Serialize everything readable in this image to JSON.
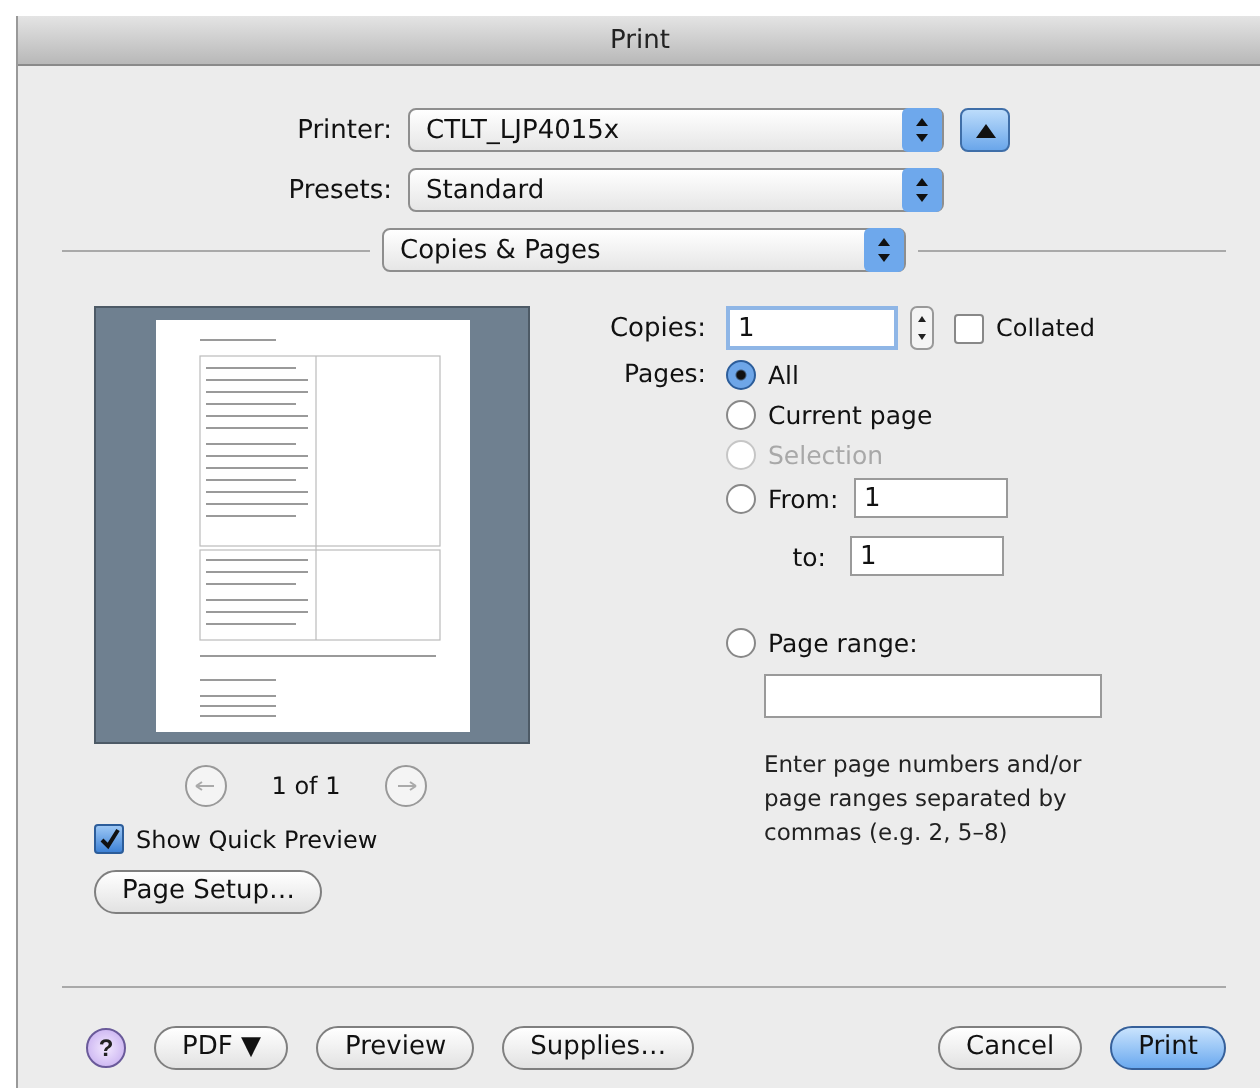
{
  "window": {
    "title": "Print"
  },
  "printer": {
    "label": "Printer:",
    "value": "CTLT_LJP4015x"
  },
  "presets": {
    "label": "Presets:",
    "value": "Standard"
  },
  "details_toggle": {
    "expanded": true
  },
  "panel_menu": {
    "value": "Copies & Pages"
  },
  "preview": {
    "page_indicator": "1 of 1",
    "quick_preview": {
      "label": "Show Quick Preview",
      "checked": true
    },
    "page_setup": "Page Setup…"
  },
  "copies": {
    "label": "Copies:",
    "value": "1",
    "collated": {
      "label": "Collated",
      "checked": false
    }
  },
  "pages": {
    "label": "Pages:",
    "options": [
      {
        "kind": "plain",
        "label": "All",
        "selected": true,
        "disabled": false
      },
      {
        "kind": "plain",
        "label": "Current page",
        "selected": false,
        "disabled": false
      },
      {
        "kind": "plain",
        "label": "Selection",
        "selected": false,
        "disabled": true
      },
      {
        "kind": "from_to",
        "label": "From:",
        "value": "1",
        "to_label": "to:",
        "to_value": "1",
        "selected": false,
        "disabled": false
      },
      {
        "kind": "range",
        "label": "Page range:",
        "hint": "Enter page numbers and/or page ranges separated by commas (e.g. 2, 5–8)",
        "selected": false,
        "disabled": false
      }
    ]
  },
  "footer": {
    "help": "?",
    "buttons": [
      {
        "label": "PDF ▼",
        "default": false
      },
      {
        "label": "Preview",
        "default": false
      },
      {
        "label": "Supplies…",
        "default": false
      },
      {
        "label": "Cancel",
        "default": false
      },
      {
        "label": "Print",
        "default": true
      }
    ]
  }
}
